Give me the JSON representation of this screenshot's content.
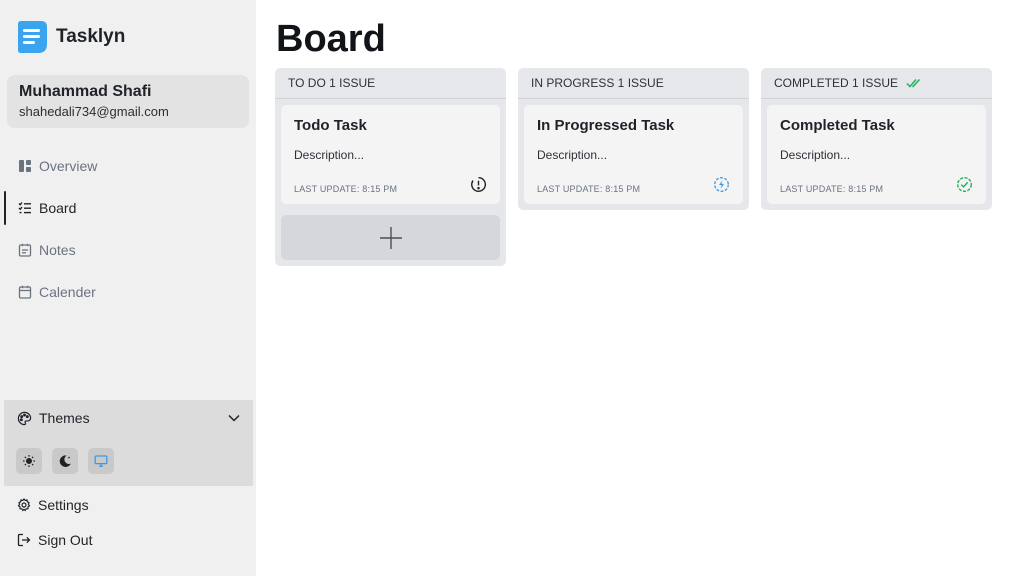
{
  "app": {
    "name": "Tasklyn"
  },
  "user": {
    "name": "Muhammad Shafi",
    "email": "shahedali734@gmail.com"
  },
  "nav": {
    "items": [
      {
        "label": "Overview",
        "icon": "overview-icon"
      },
      {
        "label": "Board",
        "icon": "board-icon",
        "active": true
      },
      {
        "label": "Notes",
        "icon": "notes-icon"
      },
      {
        "label": "Calender",
        "icon": "calendar-icon"
      }
    ]
  },
  "themes": {
    "label": "Themes",
    "options": [
      "light-theme-icon",
      "dark-theme-icon",
      "system-theme-icon"
    ]
  },
  "footer": {
    "settings_label": "Settings",
    "signout_label": "Sign Out"
  },
  "page": {
    "title": "Board"
  },
  "columns": [
    {
      "header": "TO DO 1 ISSUE",
      "cards": [
        {
          "title": "Todo Task",
          "description": "Description...",
          "updated": "LAST UPDATE: 8:15 PM",
          "status_icon": "todo-status-icon"
        }
      ],
      "has_add": true
    },
    {
      "header": "IN PROGRESS 1 ISSUE",
      "cards": [
        {
          "title": "In Progressed Task",
          "description": "Description...",
          "updated": "LAST UPDATE: 8:15 PM",
          "status_icon": "in-progress-status-icon"
        }
      ]
    },
    {
      "header": "COMPLETED 1 ISSUE",
      "cards": [
        {
          "title": "Completed Task",
          "description": "Description...",
          "updated": "LAST UPDATE: 8:15 PM",
          "status_icon": "completed-status-icon"
        }
      ]
    }
  ],
  "colors": {
    "sidebar_bg": "#f0f0f0",
    "logo_blue": "#3ba4f0",
    "progress_blue": "#3b9ae8",
    "completed_green": "#22b35e"
  }
}
